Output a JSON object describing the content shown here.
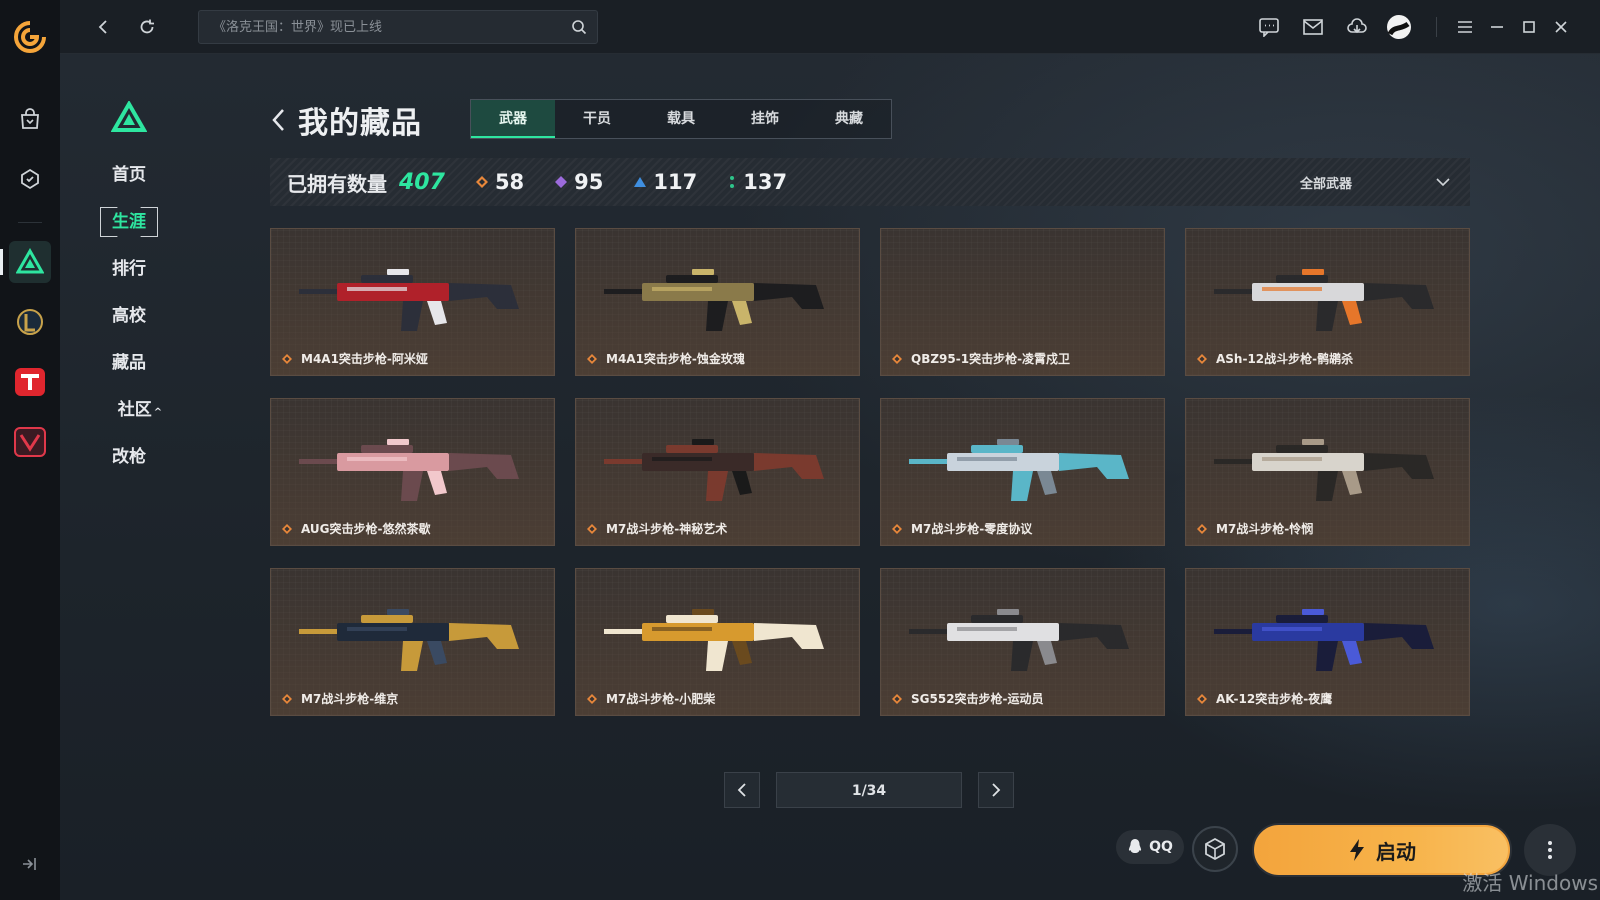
{
  "titlebar": {
    "search_placeholder": "《洛克王国：世界》现已上线"
  },
  "rail": {
    "items": [
      "store-icon",
      "game-icon",
      "valorant-app-icon",
      "lol-app-icon",
      "tga-app-icon",
      "wegame-app-icon"
    ]
  },
  "subnav": {
    "items": [
      {
        "label": "首页"
      },
      {
        "label": "生涯",
        "active": true
      },
      {
        "label": "排行"
      },
      {
        "label": "高校"
      },
      {
        "label": "藏品"
      },
      {
        "label": "社区"
      },
      {
        "label": "改枪"
      }
    ]
  },
  "page": {
    "title": "我的藏品",
    "tabs": [
      {
        "label": "武器",
        "active": true
      },
      {
        "label": "干员"
      },
      {
        "label": "载具"
      },
      {
        "label": "挂饰"
      },
      {
        "label": "典藏"
      }
    ]
  },
  "stats": {
    "owned_label": "已拥有数量",
    "owned_count": "407",
    "rarities": [
      {
        "count": "58",
        "color": "#e8873a",
        "icon": "orange-diamond-icon"
      },
      {
        "count": "95",
        "color": "#9c6bdc",
        "icon": "purple-diamond-icon"
      },
      {
        "count": "117",
        "color": "#3f8fe0",
        "icon": "blue-triangle-icon"
      },
      {
        "count": "137",
        "color": "#2ec48a",
        "icon": "green-dots-icon"
      }
    ],
    "filter_label": "全部武器"
  },
  "items": [
    {
      "name": "M4A1突击步枪-阿米娅",
      "colors": [
        "#b0212a",
        "#2c2f3a",
        "#e6e6ea"
      ]
    },
    {
      "name": "M4A1突击步枪-蚀金玫瑰",
      "colors": [
        "#8a7a4a",
        "#1d1d1f",
        "#c9b46a"
      ]
    },
    {
      "name": "QBZ95-1突击步枪-凌霄戍卫",
      "colors": []
    },
    {
      "name": "ASh-12战斗步枪-鹘鹕杀",
      "colors": [
        "#d8d8da",
        "#2a2a2c",
        "#e6762a"
      ]
    },
    {
      "name": "AUG突击步枪-悠然茶歇",
      "colors": [
        "#d99aa0",
        "#6b4a4e",
        "#f2c8cc"
      ]
    },
    {
      "name": "M7战斗步枪-神秘艺术",
      "colors": [
        "#3a2a28",
        "#7a3a2e",
        "#1a1a1a"
      ]
    },
    {
      "name": "M7战斗步枪-零度协议",
      "colors": [
        "#c9d3dc",
        "#5ab6c8",
        "#7a8894"
      ]
    },
    {
      "name": "M7战斗步枪-怜悯",
      "colors": [
        "#d8d4cc",
        "#2a2826",
        "#a89a88"
      ]
    },
    {
      "name": "M7战斗步枪-维京",
      "colors": [
        "#1f2a3a",
        "#c79a3a",
        "#3a4a62"
      ]
    },
    {
      "name": "M7战斗步枪-小肥柴",
      "colors": [
        "#d79a2e",
        "#f0e6d0",
        "#6a4a1e"
      ]
    },
    {
      "name": "SG552突击步枪-运动员",
      "colors": [
        "#e0e0e2",
        "#2a2a2c",
        "#8a8a8e"
      ]
    },
    {
      "name": "AK-12突击步枪-夜鹰",
      "colors": [
        "#2a3aa0",
        "#1a1d3a",
        "#4a5ad8"
      ]
    }
  ],
  "pagination": {
    "current": "1/34"
  },
  "bottom": {
    "qq_label": "QQ",
    "launch_label": "启动"
  },
  "watermark": "激活 Windows"
}
